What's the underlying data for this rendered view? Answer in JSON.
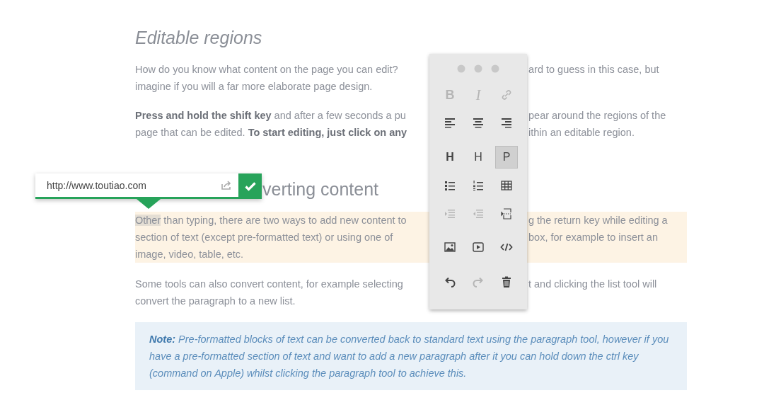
{
  "sections": [
    {
      "kind": "heading",
      "italic": true,
      "text": "Editable regions"
    },
    {
      "kind": "paragraph",
      "lines": [
        {
          "text": "How do you know what content on the page you can edit?",
          "after": "ard to guess in this case, but"
        },
        {
          "text": "imagine if you will a far more elaborate page design."
        }
      ]
    },
    {
      "kind": "paragraph",
      "lines": [
        {
          "text": "**Press and hold the shift key** and after a few seconds a pu",
          "after": "pear around the regions of the"
        },
        {
          "text": "page that can be edited. **To start editing, just click on any**",
          "after": "ithin an editable region."
        }
      ]
    },
    {
      "kind": "heading",
      "italic": false,
      "text": "verting content"
    },
    {
      "kind": "paragraph",
      "focused": true,
      "lines": [
        {
          "selection": "Other",
          "text": " than typing, there are two ways to add new content to",
          "after": "g the return key while editing a"
        },
        {
          "text": "section of text (except pre-formatted text) or using one of",
          "after": "box, for example to insert an"
        },
        {
          "text": "image, video, table, etc."
        }
      ]
    },
    {
      "kind": "paragraph",
      "lines": [
        {
          "text": "Some tools can also convert content, for example selecting",
          "after": "t and clicking the list tool will"
        },
        {
          "text": "convert the paragraph to a new list."
        }
      ]
    },
    {
      "kind": "note",
      "text": "**Note:** Pre-formatted blocks of text can be converted back to standard text using the paragraph tool, however if you have a pre-formatted section of text and want to add a new paragraph after it you can hold down the ctrl key (command on Apple) whilst clicking the paragraph tool to achieve this."
    }
  ],
  "link_popup": {
    "value": "http://www.toutiao.com"
  },
  "toolbox": {
    "groups": [
      [
        {
          "kind": "bold",
          "label": "B",
          "disabled": true,
          "selected": false
        },
        {
          "kind": "italic",
          "label": "I",
          "disabled": true,
          "selected": false
        },
        {
          "kind": "link",
          "disabled": true,
          "selected": false
        }
      ],
      [
        {
          "kind": "align-left",
          "disabled": false,
          "selected": false
        },
        {
          "kind": "align-center",
          "disabled": false,
          "selected": false
        },
        {
          "kind": "align-right",
          "disabled": false,
          "selected": false
        }
      ],
      [
        {
          "kind": "heading",
          "label": "H",
          "disabled": false,
          "selected": false
        },
        {
          "kind": "subheading",
          "label": "H",
          "disabled": false,
          "selected": false
        },
        {
          "kind": "paragraph",
          "label": "P",
          "disabled": false,
          "selected": true
        }
      ],
      [
        {
          "kind": "bullet-list",
          "disabled": false,
          "selected": false
        },
        {
          "kind": "numbered-list",
          "disabled": false,
          "selected": false
        },
        {
          "kind": "table",
          "disabled": false,
          "selected": false
        }
      ],
      [
        {
          "kind": "indent",
          "disabled": true,
          "selected": false
        },
        {
          "kind": "unindent",
          "disabled": true,
          "selected": false
        },
        {
          "kind": "line-break",
          "disabled": false,
          "selected": false
        }
      ],
      [
        {
          "kind": "image",
          "disabled": false,
          "selected": false
        },
        {
          "kind": "video",
          "disabled": false,
          "selected": false
        },
        {
          "kind": "code",
          "disabled": false,
          "selected": false
        }
      ],
      [
        {
          "kind": "undo",
          "disabled": false,
          "selected": false
        },
        {
          "kind": "redo",
          "disabled": true,
          "selected": false
        },
        {
          "kind": "delete",
          "disabled": false,
          "selected": false
        }
      ]
    ]
  }
}
